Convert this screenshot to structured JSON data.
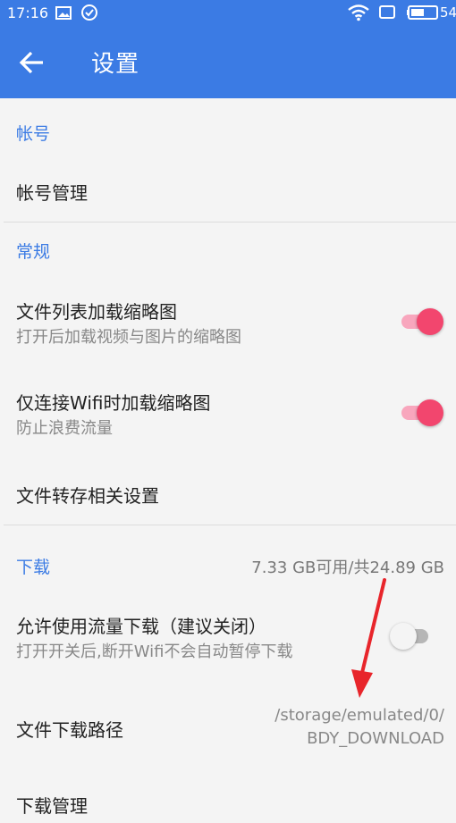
{
  "status_bar": {
    "time": "17:16",
    "battery": "54",
    "icons": [
      "image-icon",
      "check-circle-icon",
      "wifi-icon",
      "screen-icon",
      "battery-icon"
    ]
  },
  "app_bar": {
    "title": "设置",
    "back_icon": "arrow-back-icon"
  },
  "sections": {
    "account": {
      "header": "帐号",
      "items": [
        {
          "title": "帐号管理"
        }
      ]
    },
    "general": {
      "header": "常规",
      "items": [
        {
          "title": "文件列表加载缩略图",
          "subtitle": "打开后加载视频与图片的缩略图",
          "toggle": true
        },
        {
          "title": "仅连接Wifi时加载缩略图",
          "subtitle": "防止浪费流量",
          "toggle": true
        },
        {
          "title": "文件转存相关设置"
        }
      ]
    },
    "download": {
      "header": "下载",
      "storage": "7.33 GB可用/共24.89 GB",
      "items": [
        {
          "title": "允许使用流量下载（建议关闭）",
          "subtitle": "打开开关后,断开Wifi不会自动暂停下载",
          "toggle": false
        },
        {
          "title": "文件下载路径",
          "value_line1": "/storage/emulated/0/",
          "value_line2": "BDY_DOWNLOAD"
        },
        {
          "title": "下载管理"
        }
      ]
    }
  },
  "colors": {
    "primary": "#3b7be4",
    "switch_on": "#f2466e",
    "annotation_arrow": "#e8252b"
  }
}
